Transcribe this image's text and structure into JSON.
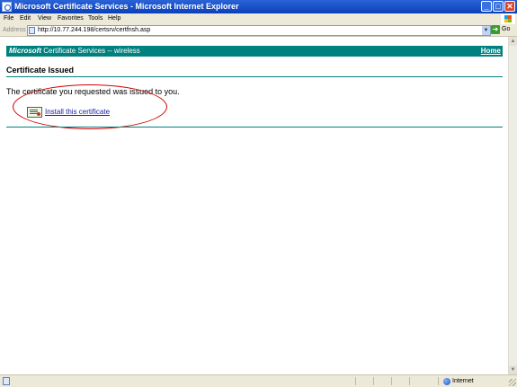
{
  "window": {
    "title": "Microsoft Certificate Services - Microsoft Internet Explorer",
    "controls": {
      "minimize": "_",
      "maximize": "□",
      "close": "✕"
    }
  },
  "menu": {
    "items": [
      "File",
      "Edit",
      "View",
      "Favorites",
      "Tools",
      "Help"
    ]
  },
  "address_bar": {
    "label": "Address",
    "url": "http://10.77.244.198/certsrv/certfnsh.asp",
    "go_label": "Go"
  },
  "page": {
    "header": {
      "brand_logo": "Microsoft",
      "brand_rest": " Certificate Services  --  wireless",
      "home_link": "Home",
      "color": "#00807f"
    },
    "heading": "Certificate Issued",
    "message": "The certificate you requested was issued to you.",
    "install_link": "Install this certificate",
    "icon": "certificate-icon"
  },
  "status_bar": {
    "zone": "Internet"
  },
  "colors": {
    "title_bar": "#0a3fb8",
    "accent": "#00807f",
    "annotation": "#d00000"
  }
}
